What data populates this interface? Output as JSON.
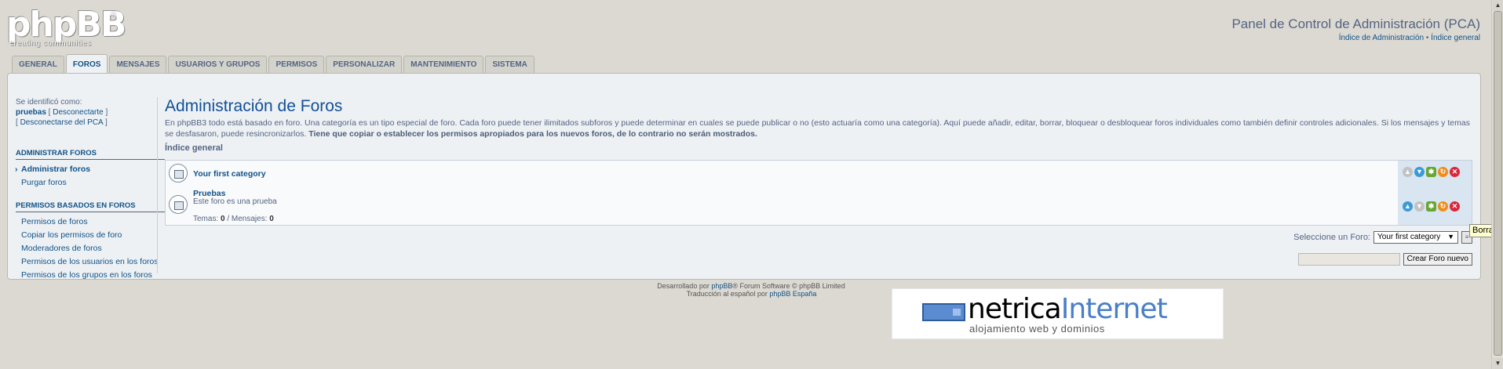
{
  "header": {
    "logo_text": "phpBB",
    "logo_reg": "®",
    "logo_tagline": "creating communities",
    "title": "Panel de Control de Administración (PCA)",
    "link_admin_index": "Índice de Administración",
    "link_separator": " • ",
    "link_general_index": "Índice general"
  },
  "tabs": [
    "GENERAL",
    "FOROS",
    "MENSAJES",
    "USUARIOS Y GRUPOS",
    "PERMISOS",
    "PERSONALIZAR",
    "MANTENIMIENTO",
    "SISTEMA"
  ],
  "active_tab": "FOROS",
  "sidebar": {
    "login_label": "Se identificó como:",
    "username": "pruebas",
    "logout_open": " [ ",
    "logout_link": "Desconectarte",
    "logout_close": " ]",
    "disconnect_pca_open": "[ ",
    "disconnect_pca_link": "Desconectarse del PCA",
    "disconnect_pca_close": " ]",
    "section1_title": "ADMINISTRAR FOROS",
    "section1_items": [
      "Administrar foros",
      "Purgar foros"
    ],
    "section2_title": "PERMISOS BASADOS EN FOROS",
    "section2_items": [
      "Permisos de foros",
      "Copiar los permisos de foro",
      "Moderadores de foros",
      "Permisos de los usuarios en los foros",
      "Permisos de los grupos en los foros"
    ]
  },
  "main": {
    "heading": "Administración de Foros",
    "intro": "En phpBB3 todo está basado en foro. Una categoría es un tipo especial de foro. Cada foro puede tener ilimitados subforos y puede determinar en cuales se puede publicar o no (esto actuaría como una categoría). Aquí puede añadir, editar, borrar, bloquear o desbloquear foros individuales como también definir controles adicionales. Si los mensajes y temas se desfasaron, puede resincronizarlos. ",
    "intro_bold": "Tiene que copiar o establecer los permisos apropiados para los nuevos foros, de lo contrario no serán mostrados.",
    "breadcrumb": "Índice general",
    "forums": [
      {
        "title": "Your first category"
      },
      {
        "title": "Pruebas",
        "description": "Este foro es una prueba",
        "topics_label": "Temas: ",
        "topics": "0",
        "posts_label": " / Mensajes: ",
        "posts": "0"
      }
    ],
    "select_label": "Seleccione un Foro:",
    "select_value": "Your first category",
    "tooltip": "Borrar",
    "create_button": "Crear Foro nuevo"
  },
  "footer": {
    "line1_prefix": "Desarrollado por ",
    "line1_link": "phpBB",
    "line1_suffix": "® Forum Software © phpBB Limited",
    "line2_prefix": "Traducción al español por ",
    "line2_link": "phpBB España"
  },
  "banner": {
    "word1": "netrica",
    "word2": "Internet",
    "tagline": "alojamiento web y dominios"
  }
}
